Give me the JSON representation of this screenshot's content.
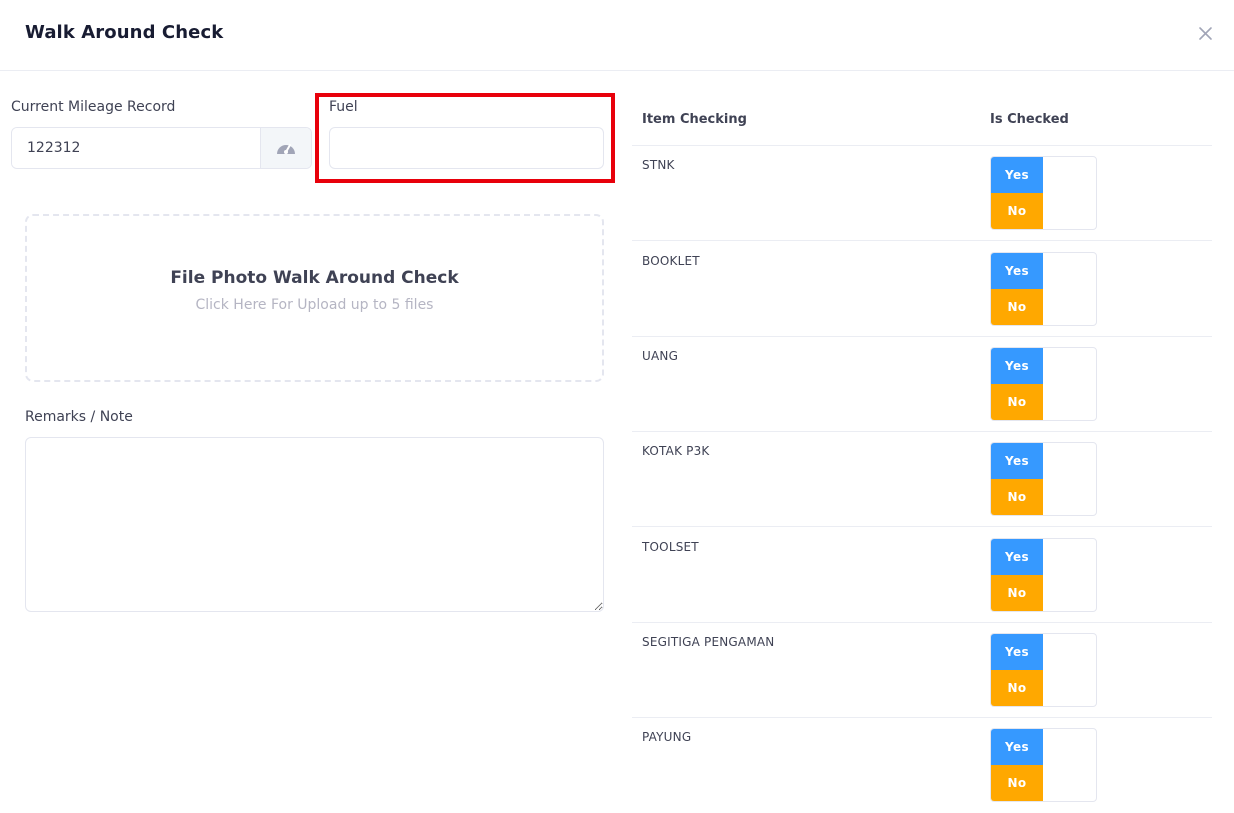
{
  "modal": {
    "title": "Walk Around Check",
    "close_icon": "close-icon"
  },
  "form": {
    "mileage_label": "Current Mileage Record",
    "mileage_value": "122312",
    "mileage_icon": "speedometer-icon",
    "fuel_label": "Fuel",
    "fuel_value": "",
    "upload_title": "File Photo Walk Around Check",
    "upload_subtitle": "Click Here For Upload up to 5 files",
    "remarks_label": "Remarks / Note",
    "remarks_value": ""
  },
  "checklist": {
    "header_item": "Item Checking",
    "header_checked": "Is Checked",
    "yes_label": "Yes",
    "no_label": "No",
    "items": [
      {
        "label": "STNK"
      },
      {
        "label": "BOOKLET"
      },
      {
        "label": "UANG"
      },
      {
        "label": "KOTAK P3K"
      },
      {
        "label": "TOOLSET"
      },
      {
        "label": "SEGITIGA PENGAMAN"
      },
      {
        "label": "PAYUNG"
      }
    ]
  },
  "colors": {
    "yes": "#3699ff",
    "no": "#ffa800",
    "highlight": "#e8000b"
  }
}
